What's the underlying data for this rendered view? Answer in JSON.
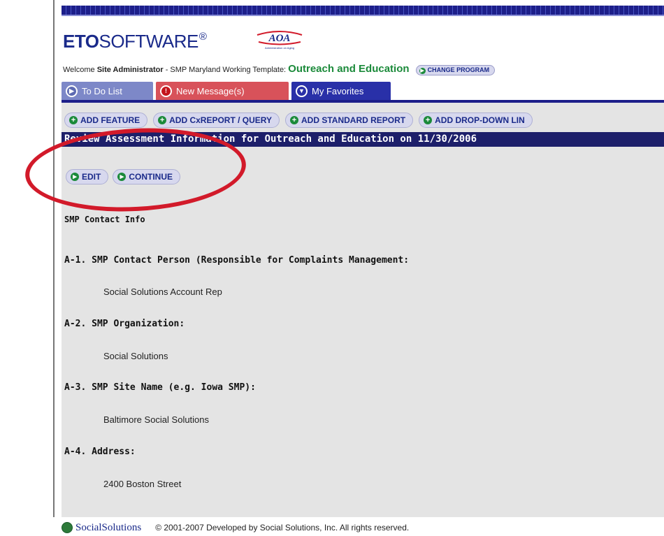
{
  "header": {
    "logo_bold": "ETO",
    "logo_rest": "SOFTWARE",
    "logo_reg": "®",
    "aoa_logo_text": "AOA",
    "aoa_logo_sub": "Administration on Aging"
  },
  "welcome": {
    "prefix": "Welcome ",
    "user": "Site Administrator",
    "template": " - SMP Maryland Working Template: ",
    "program": "Outreach and Education",
    "change_program": "CHANGE PROGRAM"
  },
  "tabs": [
    {
      "label": "To Do List",
      "icon": "arrow-right-icon"
    },
    {
      "label": "New Message(s)",
      "icon": "alert-icon"
    },
    {
      "label": "My Favorites",
      "icon": "chevron-down-icon"
    }
  ],
  "toolbar": {
    "add_feature": "ADD FEATURE",
    "add_cxreport": "ADD CxREPORT / QUERY",
    "add_standard_report": "ADD STANDARD REPORT",
    "add_dropdown": "ADD DROP-DOWN LIN"
  },
  "title": "Review Assessment Information for Outreach and Education on 11/30/2006",
  "actions": {
    "edit": "EDIT",
    "continue": "CONTINUE"
  },
  "section_title": "SMP Contact Info",
  "questions": [
    {
      "label": "A-1. SMP Contact Person (Responsible for Complaints Management:",
      "answer": "Social Solutions Account Rep"
    },
    {
      "label": "A-2. SMP Organization:",
      "answer": "Social Solutions"
    },
    {
      "label": "A-3. SMP Site Name (e.g. Iowa SMP):",
      "answer": "Baltimore Social Solutions"
    },
    {
      "label": "A-4. Address:",
      "answer": "2400 Boston Street"
    }
  ],
  "footer": {
    "brand": "SocialSolutions",
    "copyright": "© 2001-2007 Developed by Social Solutions, Inc. All rights reserved."
  },
  "colors": {
    "navy": "#1d1f6a",
    "green": "#1b8a3a",
    "red_annotation": "#d21a2a",
    "content_bg": "#e4e4e4"
  }
}
